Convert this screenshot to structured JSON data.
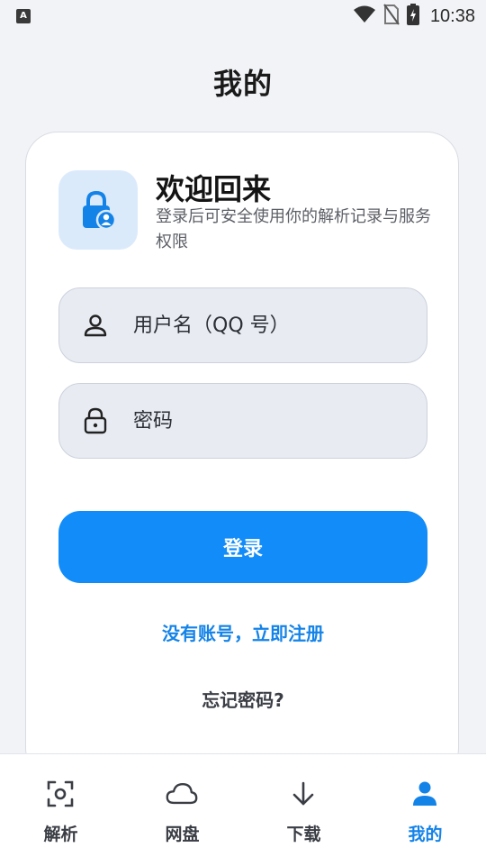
{
  "status_bar": {
    "time": "10:38",
    "left_icon": "A",
    "icons": [
      "wifi-icon",
      "no-sim-icon",
      "battery-charging-icon"
    ]
  },
  "page_title": "我的",
  "card": {
    "title": "欢迎回来",
    "subtitle": "登录后可安全使用你的解析记录与服务权限",
    "lock_icon": "lock-user-icon",
    "username": {
      "placeholder": "用户名（QQ 号）",
      "icon": "user-icon",
      "value": ""
    },
    "password": {
      "placeholder": "密码",
      "icon": "lock-icon",
      "value": ""
    },
    "login_label": "登录",
    "register_label": "没有账号，立即注册",
    "forgot_label": "忘记密码?"
  },
  "bottom_nav": {
    "items": [
      {
        "label": "解析",
        "icon": "scan-icon",
        "active": false
      },
      {
        "label": "网盘",
        "icon": "cloud-icon",
        "active": false
      },
      {
        "label": "下载",
        "icon": "download-arrow-icon",
        "active": false
      },
      {
        "label": "我的",
        "icon": "person-icon",
        "active": true
      }
    ]
  },
  "colors": {
    "accent": "#118cf8",
    "link": "#1483e8",
    "background": "#f2f3f6",
    "field_bg": "#e8ebf2",
    "tile_bg": "#dbeafb"
  }
}
